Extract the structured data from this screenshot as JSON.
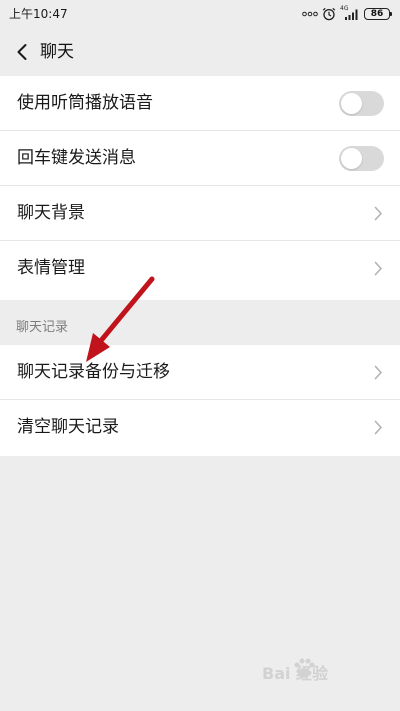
{
  "status_bar": {
    "time": "上午10:47",
    "network_label": "4G",
    "battery_level": "86",
    "icons": [
      "dots-icon",
      "alarm-icon",
      "signal-icon",
      "battery-icon"
    ]
  },
  "header": {
    "title": "聊天",
    "back_icon": "chevron-left-icon"
  },
  "settings": {
    "toggles": [
      {
        "label": "使用听筒播放语音",
        "enabled": false
      },
      {
        "label": "回车键发送消息",
        "enabled": false
      }
    ],
    "links": [
      {
        "label": "聊天背景"
      },
      {
        "label": "表情管理"
      }
    ]
  },
  "chat_history": {
    "section_label": "聊天记录",
    "items": [
      {
        "label": "聊天记录备份与迁移"
      },
      {
        "label": "清空聊天记录"
      }
    ]
  },
  "annotation": {
    "arrow_color": "#c0131b",
    "points_to": "聊天记录备份与迁移"
  },
  "watermark": {
    "text": "Bai 经验",
    "icon": "paw-icon"
  },
  "colors": {
    "background": "#ededed",
    "card": "#ffffff",
    "toggle_off": "#d9d9d9",
    "section_label": "#7d7d7d"
  }
}
